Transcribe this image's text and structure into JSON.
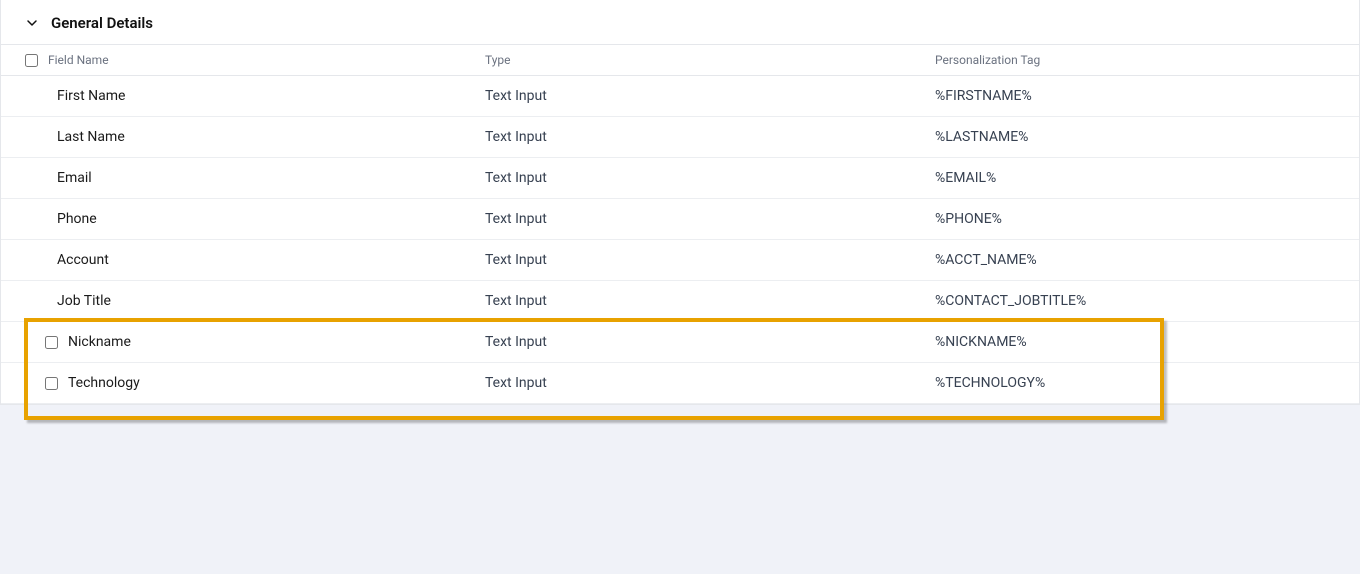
{
  "section": {
    "title": "General Details"
  },
  "headers": {
    "field_name": "Field Name",
    "type": "Type",
    "personalization_tag": "Personalization Tag"
  },
  "rows": [
    {
      "checkbox": false,
      "field": "First Name",
      "type": "Text Input",
      "tag": "%FIRSTNAME%"
    },
    {
      "checkbox": false,
      "field": "Last Name",
      "type": "Text Input",
      "tag": "%LASTNAME%"
    },
    {
      "checkbox": false,
      "field": "Email",
      "type": "Text Input",
      "tag": "%EMAIL%"
    },
    {
      "checkbox": false,
      "field": "Phone",
      "type": "Text Input",
      "tag": "%PHONE%"
    },
    {
      "checkbox": false,
      "field": "Account",
      "type": "Text Input",
      "tag": "%ACCT_NAME%"
    },
    {
      "checkbox": false,
      "field": "Job Title",
      "type": "Text Input",
      "tag": "%CONTACT_JOBTITLE%"
    },
    {
      "checkbox": true,
      "field": "Nickname",
      "type": "Text Input",
      "tag": "%NICKNAME%"
    },
    {
      "checkbox": true,
      "field": "Technology",
      "type": "Text Input",
      "tag": "%TECHNOLOGY%"
    }
  ],
  "highlight": {
    "start_index": 6,
    "end_index": 7
  }
}
